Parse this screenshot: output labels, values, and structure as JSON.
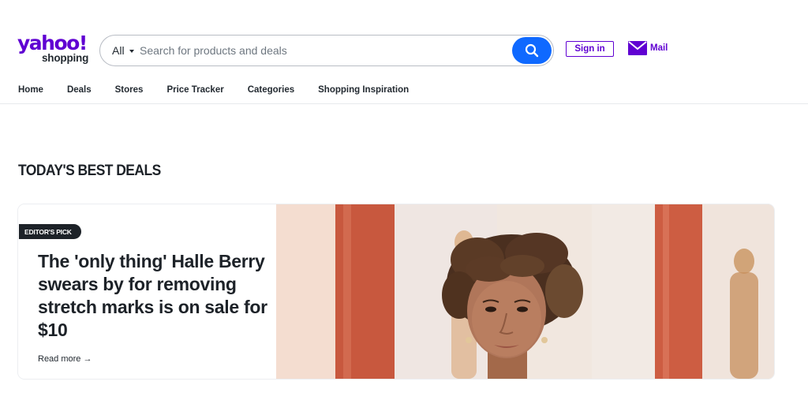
{
  "brand": {
    "logo_main": "yahoo!",
    "logo_sub": "shopping"
  },
  "search": {
    "category": "All",
    "placeholder": "Search for products and deals"
  },
  "header": {
    "signin_label": "Sign in",
    "mail_label": "Mail"
  },
  "nav": {
    "items": [
      {
        "label": "Home"
      },
      {
        "label": "Deals"
      },
      {
        "label": "Stores"
      },
      {
        "label": "Price Tracker"
      },
      {
        "label": "Categories"
      },
      {
        "label": "Shopping Inspiration"
      }
    ]
  },
  "section": {
    "title": "TODAY'S BEST DEALS"
  },
  "featured": {
    "badge": "EDITOR'S PICK",
    "headline": "The 'only thing' Halle Berry swears by for removing stretch marks is on sale for $10",
    "read_more": "Read more →"
  },
  "colors": {
    "brand": "#6001d2",
    "search_button": "#0f69ff",
    "text": "#1d2228"
  },
  "icons": {
    "search": "search-icon",
    "mail": "mail-icon",
    "caret": "caret-down-icon"
  }
}
